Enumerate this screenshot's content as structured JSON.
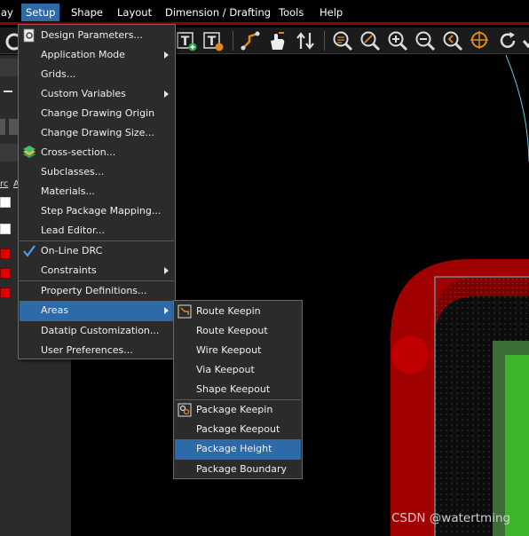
{
  "menubar": {
    "items": [
      {
        "label": "ay"
      },
      {
        "label": "Setup"
      },
      {
        "label": "Shape"
      },
      {
        "label": "Layout"
      },
      {
        "label": "Dimension / Drafting"
      },
      {
        "label": "Tools"
      },
      {
        "label": "Help"
      }
    ]
  },
  "colors": {
    "menu_bg": "#2b2b2b",
    "highlight": "#2f6aa8",
    "menubar_border": "#8b0000",
    "copper_red": "#a00000",
    "pad_red": "#c00000",
    "green": "#3cb52b",
    "dark_green": "#3a6e34",
    "cyan_outline": "#5fc8d8"
  },
  "toolbar": {
    "icons": [
      "text-add-icon",
      "text-edit-icon",
      "route-icon",
      "slide-hand-icon",
      "swap-icon",
      "zoom-fit-icon",
      "zoom-window-icon",
      "zoom-in-icon",
      "zoom-out-icon",
      "zoom-previous-icon",
      "zoom-center-icon",
      "zoom-world-icon",
      "redraw-icon",
      "check-icon"
    ]
  },
  "left_panel": {
    "labels": [
      "rc",
      "A"
    ]
  },
  "setup_menu": {
    "items": [
      {
        "label": "Design Parameters...",
        "icon": "design-params-icon"
      },
      {
        "label": "Application Mode",
        "submenu": true
      },
      {
        "label": "Grids..."
      },
      {
        "label": "Custom Variables",
        "submenu": true
      },
      {
        "label": "Change Drawing Origin"
      },
      {
        "label": "Change Drawing Size..."
      },
      {
        "label": "Cross-section...",
        "icon": "cross-section-icon"
      },
      {
        "label": "Subclasses..."
      },
      {
        "label": "Materials..."
      },
      {
        "label": "Step Package Mapping..."
      },
      {
        "label": "Lead Editor..."
      },
      {
        "label": "On-Line DRC",
        "checked": true
      },
      {
        "label": "Constraints",
        "submenu": true
      },
      {
        "label": "Property Definitions..."
      },
      {
        "label": "Areas",
        "submenu": true,
        "highlighted": true
      },
      {
        "label": "Datatip Customization..."
      },
      {
        "label": "User Preferences..."
      }
    ]
  },
  "areas_menu": {
    "items": [
      {
        "label": "Route Keepin",
        "icon": "route-keepin-icon"
      },
      {
        "label": "Route Keepout"
      },
      {
        "label": "Wire Keepout"
      },
      {
        "label": "Via Keepout"
      },
      {
        "label": "Shape Keepout"
      },
      {
        "label": "Package Keepin",
        "icon": "package-keepin-icon"
      },
      {
        "label": "Package Keepout"
      },
      {
        "label": "Package Height",
        "highlighted": true
      },
      {
        "label": "Package Boundary"
      }
    ]
  },
  "watermark": "CSDN @watertming"
}
